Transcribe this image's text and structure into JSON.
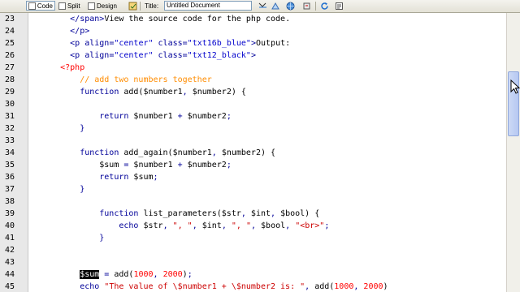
{
  "toolbar": {
    "code_label": "Code",
    "split_label": "Split",
    "design_label": "Design",
    "title_label": "Title:",
    "title_value": "Untitled Document"
  },
  "lines": [
    {
      "num": "23",
      "indent": 8,
      "tokens": [
        [
          "t-html",
          "</span>"
        ],
        [
          "t-text",
          "View the source code for the php code."
        ]
      ]
    },
    {
      "num": "24",
      "indent": 8,
      "tokens": [
        [
          "t-html",
          "</p>"
        ]
      ]
    },
    {
      "num": "25",
      "indent": 8,
      "tokens": [
        [
          "t-html",
          "<p "
        ],
        [
          "t-attr",
          "align="
        ],
        [
          "t-str",
          "\"center\""
        ],
        [
          "t-attr",
          " class="
        ],
        [
          "t-str",
          "\"txt16b_blue\""
        ],
        [
          "t-html",
          ">"
        ],
        [
          "t-text",
          "Output:"
        ]
      ]
    },
    {
      "num": "26",
      "indent": 8,
      "tokens": [
        [
          "t-html",
          "<p "
        ],
        [
          "t-attr",
          "align="
        ],
        [
          "t-str",
          "\"center\""
        ],
        [
          "t-attr",
          " class="
        ],
        [
          "t-str",
          "\"txt12_black\""
        ],
        [
          "t-html",
          ">"
        ]
      ]
    },
    {
      "num": "27",
      "indent": 6,
      "tokens": [
        [
          "t-php",
          "<?php"
        ]
      ]
    },
    {
      "num": "28",
      "indent": 10,
      "tokens": [
        [
          "t-comment",
          "// add two numbers together"
        ]
      ]
    },
    {
      "num": "29",
      "indent": 10,
      "tokens": [
        [
          "t-kw",
          "function "
        ],
        [
          "t-var",
          "add("
        ],
        [
          "t-var",
          "$number1"
        ],
        [
          "t-punct",
          ", "
        ],
        [
          "t-var",
          "$number2"
        ],
        [
          "t-var",
          ") {"
        ]
      ]
    },
    {
      "num": "30",
      "indent": 0,
      "tokens": []
    },
    {
      "num": "31",
      "indent": 14,
      "tokens": [
        [
          "t-kw",
          "return "
        ],
        [
          "t-var",
          "$number1"
        ],
        [
          "t-op",
          " + "
        ],
        [
          "t-var",
          "$number2"
        ],
        [
          "t-punct",
          ";"
        ]
      ]
    },
    {
      "num": "32",
      "indent": 10,
      "tokens": [
        [
          "t-punct",
          "}"
        ]
      ]
    },
    {
      "num": "33",
      "indent": 0,
      "tokens": []
    },
    {
      "num": "34",
      "indent": 10,
      "tokens": [
        [
          "t-kw",
          "function "
        ],
        [
          "t-var",
          "add_again("
        ],
        [
          "t-var",
          "$number1"
        ],
        [
          "t-punct",
          ", "
        ],
        [
          "t-var",
          "$number2"
        ],
        [
          "t-var",
          ") {"
        ]
      ]
    },
    {
      "num": "35",
      "indent": 14,
      "tokens": [
        [
          "t-var",
          "$sum"
        ],
        [
          "t-op",
          " = "
        ],
        [
          "t-var",
          "$number1"
        ],
        [
          "t-op",
          " + "
        ],
        [
          "t-var",
          "$number2"
        ],
        [
          "t-punct",
          ";"
        ]
      ]
    },
    {
      "num": "36",
      "indent": 14,
      "tokens": [
        [
          "t-kw",
          "return "
        ],
        [
          "t-var",
          "$sum"
        ],
        [
          "t-punct",
          ";"
        ]
      ]
    },
    {
      "num": "37",
      "indent": 10,
      "tokens": [
        [
          "t-punct",
          "}"
        ]
      ]
    },
    {
      "num": "38",
      "indent": 0,
      "tokens": []
    },
    {
      "num": "39",
      "indent": 14,
      "tokens": [
        [
          "t-kw",
          "function "
        ],
        [
          "t-var",
          "list_parameters("
        ],
        [
          "t-var",
          "$str"
        ],
        [
          "t-punct",
          ", "
        ],
        [
          "t-var",
          "$int"
        ],
        [
          "t-punct",
          ", "
        ],
        [
          "t-var",
          "$bool"
        ],
        [
          "t-var",
          ") {"
        ]
      ]
    },
    {
      "num": "40",
      "indent": 18,
      "tokens": [
        [
          "t-kw",
          "echo "
        ],
        [
          "t-var",
          "$str"
        ],
        [
          "t-punct",
          ", "
        ],
        [
          "t-strlit",
          "\", \""
        ],
        [
          "t-punct",
          ", "
        ],
        [
          "t-var",
          "$int"
        ],
        [
          "t-punct",
          ", "
        ],
        [
          "t-strlit",
          "\", \""
        ],
        [
          "t-punct",
          ", "
        ],
        [
          "t-var",
          "$bool"
        ],
        [
          "t-punct",
          ", "
        ],
        [
          "t-strlit",
          "\"<br>\""
        ],
        [
          "t-punct",
          ";"
        ]
      ]
    },
    {
      "num": "41",
      "indent": 14,
      "tokens": [
        [
          "t-punct",
          "}"
        ]
      ]
    },
    {
      "num": "42",
      "indent": 0,
      "tokens": []
    },
    {
      "num": "43",
      "indent": 0,
      "tokens": []
    },
    {
      "num": "44",
      "indent": 10,
      "tokens": [
        [
          "t-sel",
          "$sum"
        ],
        [
          "t-op",
          " = "
        ],
        [
          "t-var",
          "add("
        ],
        [
          "t-num",
          "1000"
        ],
        [
          "t-punct",
          ", "
        ],
        [
          "t-num",
          "2000"
        ],
        [
          "t-var",
          ")"
        ],
        [
          "t-punct",
          ";"
        ]
      ]
    },
    {
      "num": "45",
      "indent": 10,
      "tokens": [
        [
          "t-kw",
          "echo "
        ],
        [
          "t-strlit",
          "\"The value of \\$number1 + \\$number2 is: \""
        ],
        [
          "t-punct",
          ", "
        ],
        [
          "t-var",
          "add("
        ],
        [
          "t-num",
          "1000"
        ],
        [
          "t-punct",
          ", "
        ],
        [
          "t-num",
          "2000"
        ],
        [
          "t-var",
          ")"
        ]
      ]
    }
  ]
}
